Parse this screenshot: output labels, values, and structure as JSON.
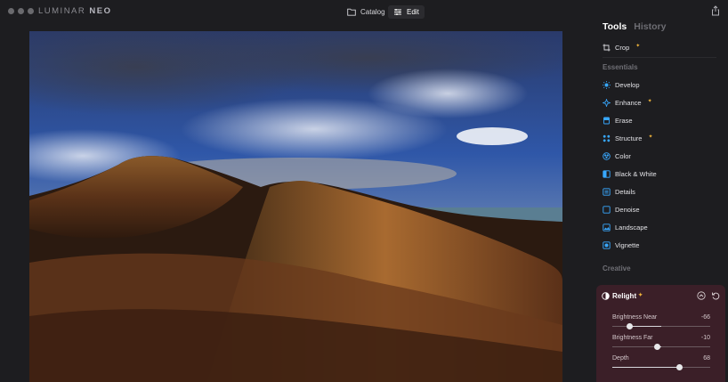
{
  "app": {
    "logo_text": "LUMINAR",
    "logo_suffix": "NEO"
  },
  "topbar": {
    "catalog_label": "Catalog",
    "edit_label": "Edit"
  },
  "panel": {
    "tabs": {
      "tools": "Tools",
      "history": "History"
    },
    "crop": {
      "label": "Crop",
      "icon": "crop-icon"
    },
    "essentials_title": "Essentials",
    "essentials": [
      {
        "label": "Develop",
        "icon": "sun-icon",
        "ai": false,
        "color": "#38a8ff"
      },
      {
        "label": "Enhance",
        "icon": "sparkle-icon",
        "ai": true,
        "color": "#38a8ff"
      },
      {
        "label": "Erase",
        "icon": "eraser-icon",
        "ai": false,
        "color": "#38a8ff"
      },
      {
        "label": "Structure",
        "icon": "structure-icon",
        "ai": true,
        "color": "#38a8ff"
      },
      {
        "label": "Color",
        "icon": "color-wheel-icon",
        "ai": false,
        "color": "#38a8ff"
      },
      {
        "label": "Black & White",
        "icon": "bw-icon",
        "ai": false,
        "color": "#38a8ff"
      },
      {
        "label": "Details",
        "icon": "details-icon",
        "ai": false,
        "color": "#38a8ff"
      },
      {
        "label": "Denoise",
        "icon": "denoise-icon",
        "ai": false,
        "color": "#38a8ff"
      },
      {
        "label": "Landscape",
        "icon": "landscape-icon",
        "ai": false,
        "color": "#38a8ff"
      },
      {
        "label": "Vignette",
        "icon": "vignette-icon",
        "ai": false,
        "color": "#38a8ff"
      }
    ],
    "creative_title": "Creative",
    "relight": {
      "title": "Relight",
      "sliders": [
        {
          "label": "Brightness Near",
          "value": "-66",
          "min": -100,
          "max": 100,
          "num": -66
        },
        {
          "label": "Brightness Far",
          "value": "-10",
          "min": -100,
          "max": 100,
          "num": -10
        },
        {
          "label": "Depth",
          "value": "68",
          "min": 0,
          "max": 100,
          "num": 68
        }
      ]
    }
  },
  "colors": {
    "accent": "#38a8ff",
    "ai_star": "#f0b43a",
    "relight_bg": "#3b1f28"
  }
}
